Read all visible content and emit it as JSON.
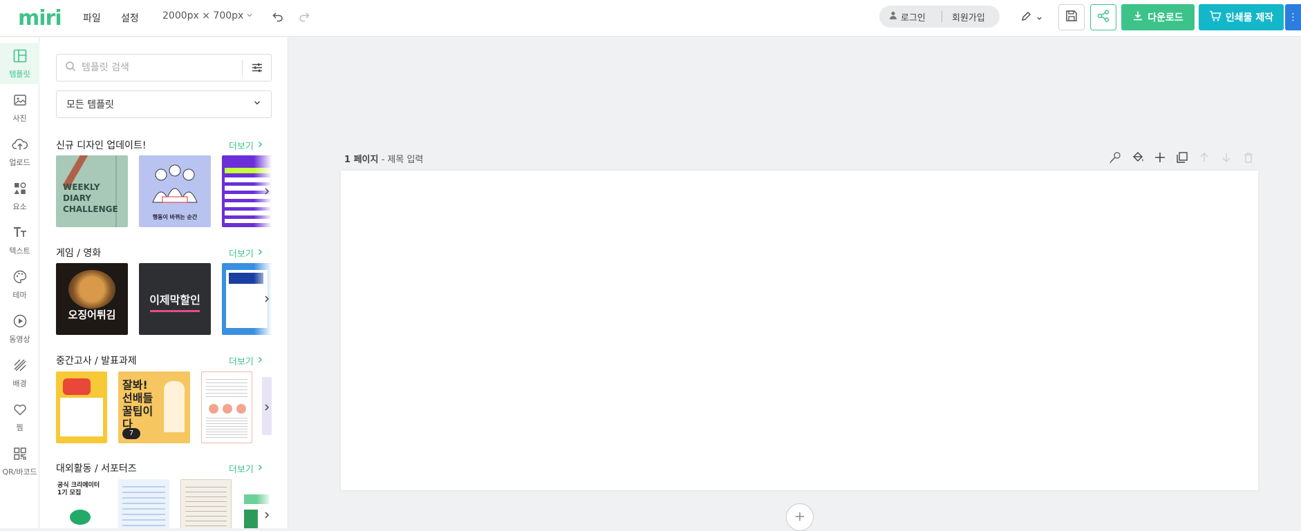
{
  "app": {
    "logo": "miri"
  },
  "menu": {
    "file": "파일",
    "settings": "설정",
    "canvas_size": "2000px × 700px"
  },
  "auth": {
    "login": "로그인",
    "signup": "회원가입"
  },
  "actions": {
    "download": "다운로드",
    "print": "인쇄물 제작",
    "more": "⋮"
  },
  "colors": {
    "accent": "#3dc38a",
    "print": "#14b7c9",
    "more": "#2b7de0"
  },
  "rail": [
    {
      "label": "템플릿",
      "icon": "layout-icon",
      "active": true
    },
    {
      "label": "사진",
      "icon": "image-icon"
    },
    {
      "label": "업로드",
      "icon": "upload-icon"
    },
    {
      "label": "요소",
      "icon": "shapes-icon"
    },
    {
      "label": "텍스트",
      "icon": "text-icon"
    },
    {
      "label": "테마",
      "icon": "palette-icon"
    },
    {
      "label": "동영상",
      "icon": "play-icon"
    },
    {
      "label": "배경",
      "icon": "pattern-icon"
    },
    {
      "label": "찜",
      "icon": "heart-icon"
    },
    {
      "label": "QR/바코드",
      "icon": "qr-icon"
    }
  ],
  "panel": {
    "search_placeholder": "템플릿 검색",
    "filter_select": "모든 템플릿",
    "sections": [
      {
        "title": "신규 디자인 업데이트!",
        "more": "더보기"
      },
      {
        "title": "게임 / 영화",
        "more": "더보기"
      },
      {
        "title": "중간고사 / 발표과제",
        "more": "더보기"
      },
      {
        "title": "대외활동 / 서포터즈",
        "more": "더보기"
      }
    ],
    "thumb_texts": {
      "weekly": "WEEKLY DIARY CHALLENGE",
      "moment": "행동이 바뀌는 순간",
      "squid": "오징어튀김",
      "sale": "이제막할인",
      "jalbwa": "잘봐! 선배들 꿀팁이다",
      "page_count": "7",
      "creator": "공식 크리에이터 1기 모집"
    }
  },
  "canvas": {
    "page_number": "1 페이지",
    "page_title_placeholder": "- 제목 입력"
  }
}
